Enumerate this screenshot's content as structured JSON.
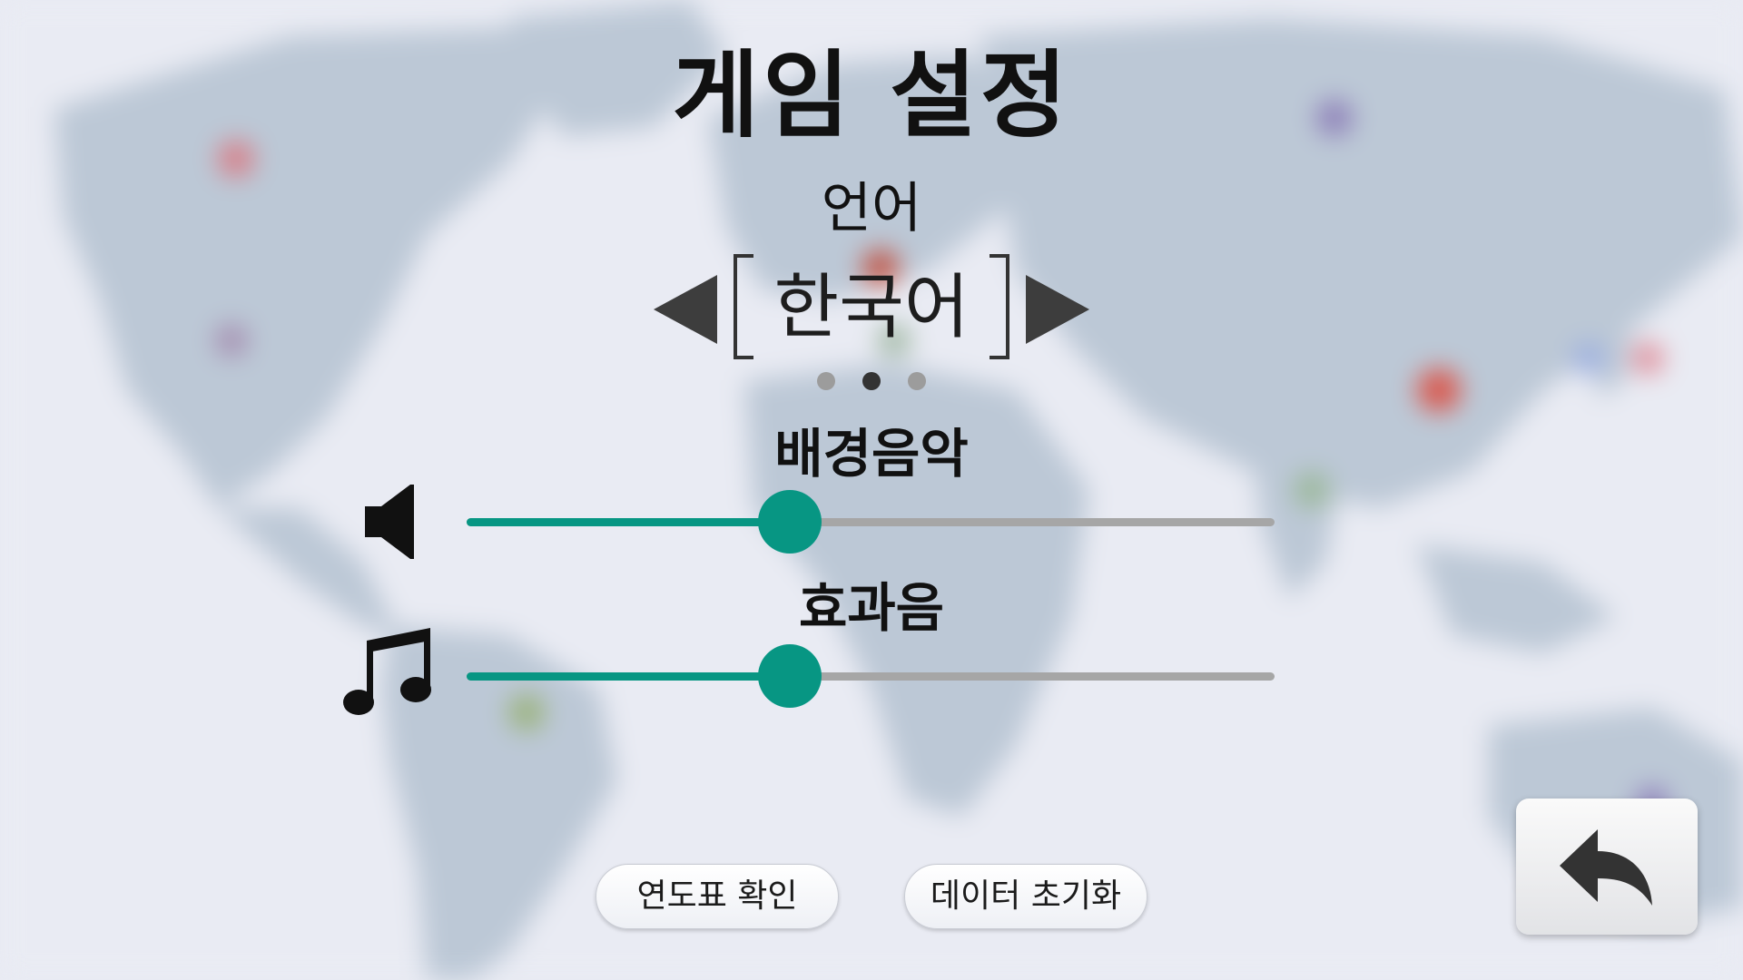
{
  "screen": {
    "title": "게임 설정"
  },
  "language": {
    "label": "언어",
    "value": "한국어",
    "page_count": 3,
    "current_page": 2,
    "prev_icon": "triangle-left-icon",
    "next_icon": "triangle-right-icon"
  },
  "bgm": {
    "label": "배경음악",
    "icon": "speaker-icon",
    "level": 0.4
  },
  "sfx": {
    "label": "효과음",
    "icon": "music-note-icon",
    "level": 0.4
  },
  "buttons": {
    "timeline_label": "연도표 확인",
    "reset_label": "데이터 초기화",
    "back_icon": "back-arrow-icon"
  },
  "colors": {
    "accent": "#079683",
    "track": "#a6a6a6",
    "arrow": "#3d3d3d",
    "background": "#e9ebf3",
    "map_land": "#bcc8d6"
  }
}
